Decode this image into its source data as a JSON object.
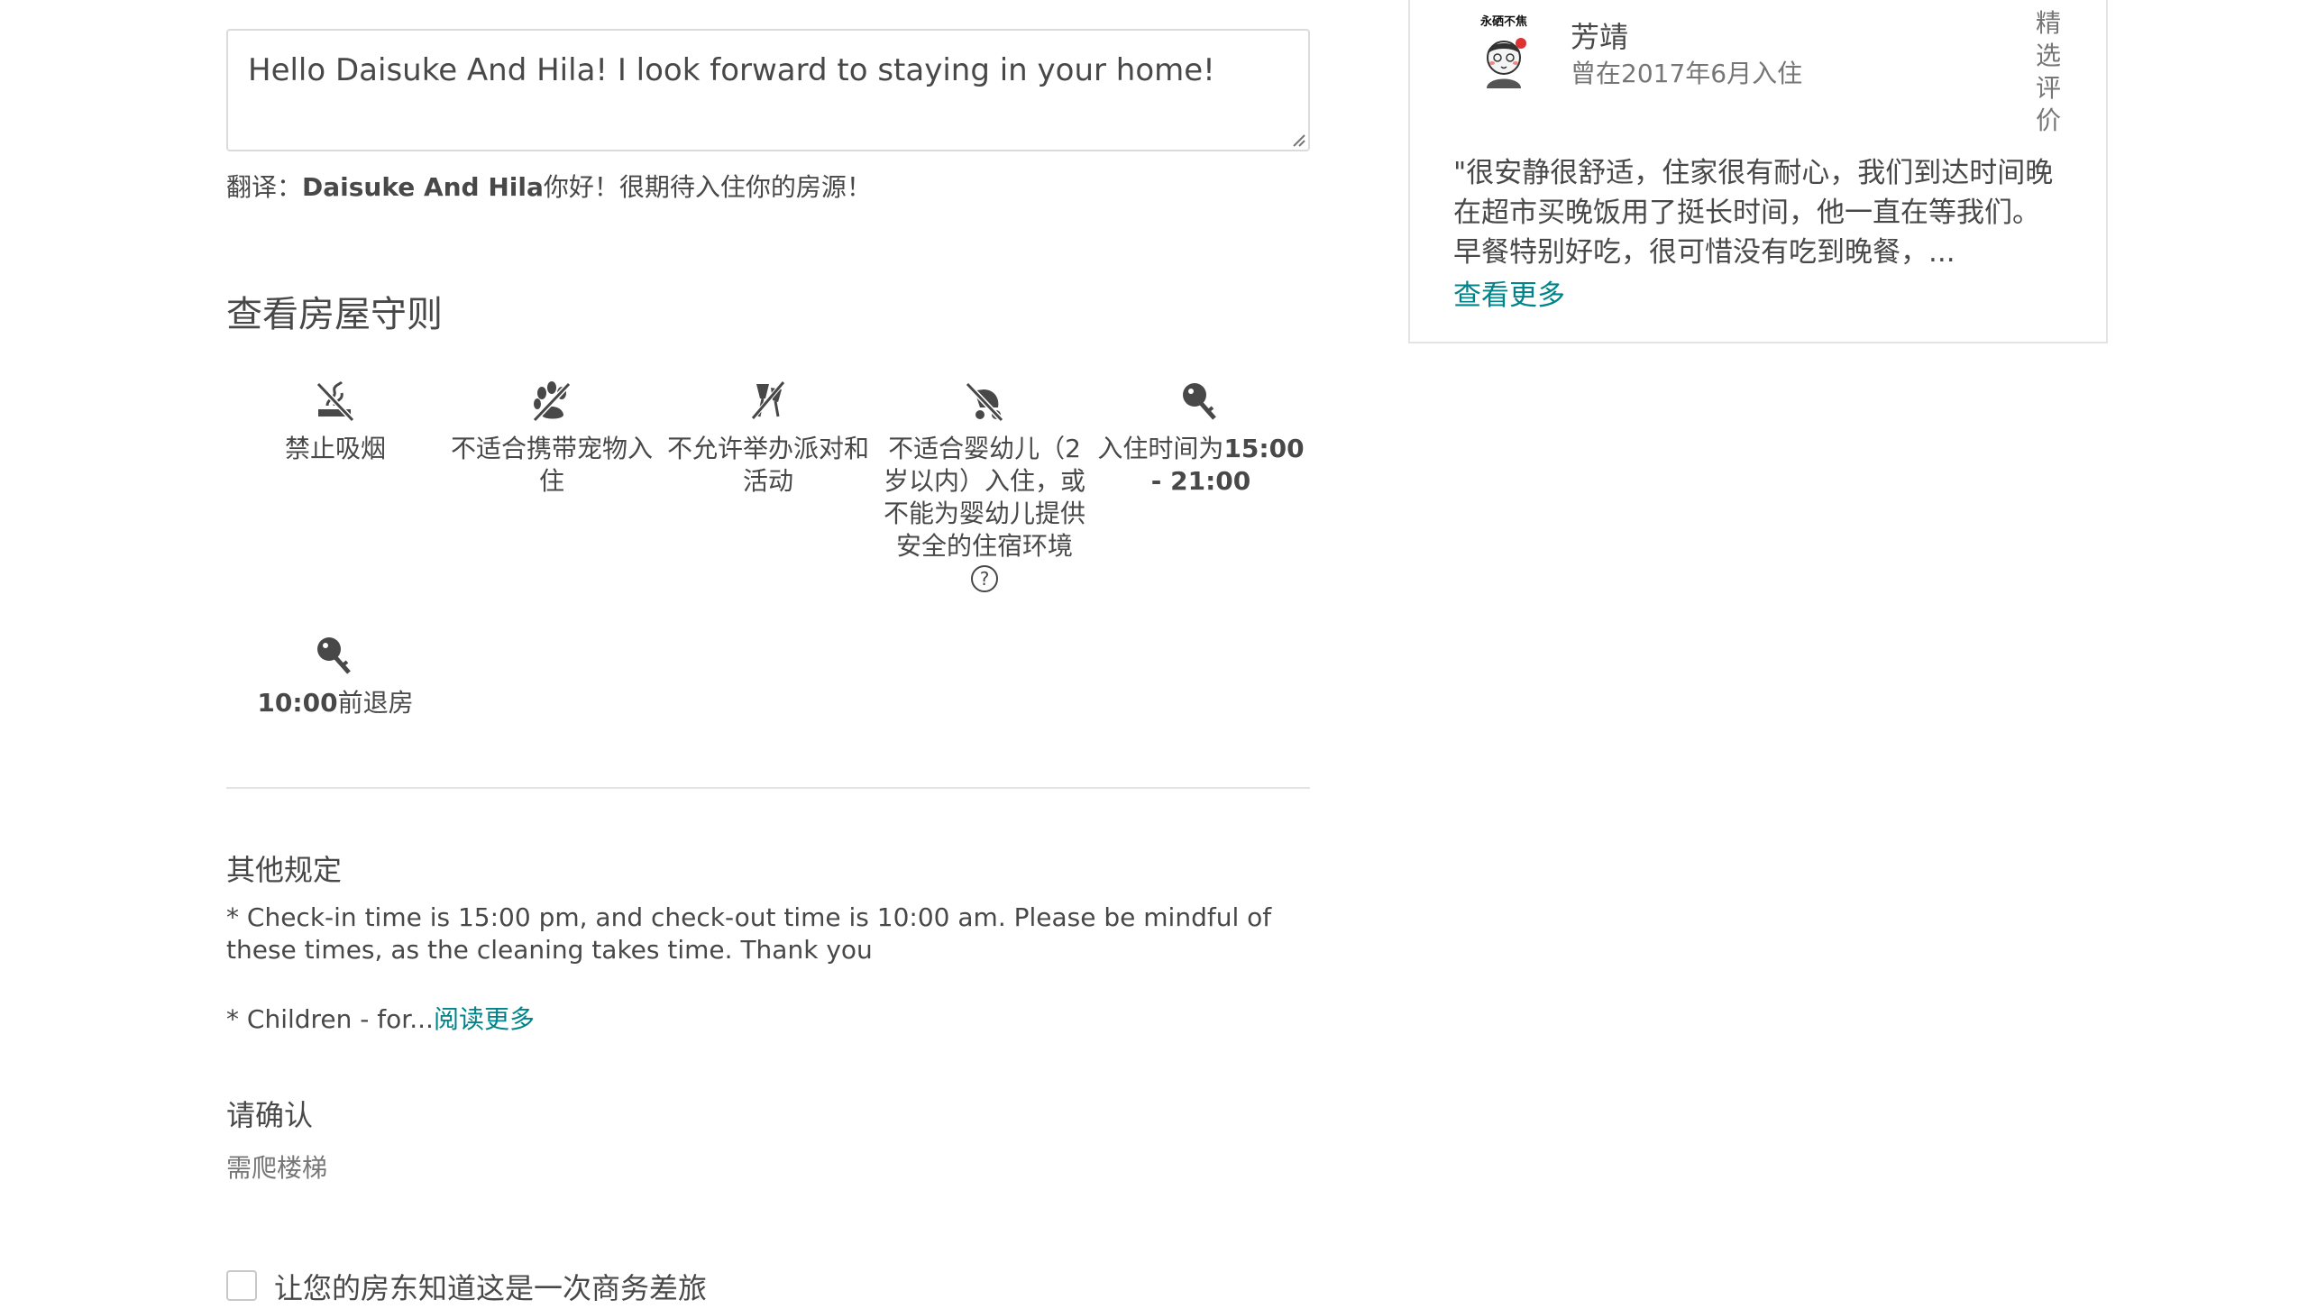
{
  "message": {
    "text": "Hello Daisuke And Hila! I look forward to staying in your home!",
    "translation_prefix": "翻译：",
    "translation_host": "Daisuke And Hila",
    "translation_rest": "你好！很期待入住你的房源！"
  },
  "house_rules": {
    "title": "查看房屋守则",
    "rules": [
      {
        "icon": "no-smoking-icon",
        "label": "禁止吸烟"
      },
      {
        "icon": "no-pets-icon",
        "label": "不适合携带宠物入住"
      },
      {
        "icon": "no-parties-icon",
        "label": "不允许举办派对和活动"
      },
      {
        "icon": "no-infants-icon",
        "label": "不适合婴幼儿（2岁以内）入住，或不能为婴幼儿提供安全的住宿环境"
      },
      {
        "icon": "key-icon",
        "label_prefix": "入住时间为",
        "label_bold": "15:00 - 21:00"
      },
      {
        "icon": "key-icon",
        "label_bold": "10:00",
        "label_suffix": "前退房"
      }
    ]
  },
  "other_rules": {
    "title": "其他规定",
    "text": "* Check-in time is 15:00 pm, and check-out time is 10:00 am. Please be mindful of these times, as the cleaning takes time. Thank you",
    "children_text": "* Children - for...",
    "read_more": "阅读更多"
  },
  "confirm": {
    "title": "请确认",
    "text": "需爬楼梯"
  },
  "business_trip": {
    "label": "让您的房东知道这是一次商务差旅",
    "checked": false
  },
  "review": {
    "avatar_caption": "永硒不焦",
    "reviewer_name": "芳靖",
    "stay_date": "曾在2017年6月入住",
    "badge": "精选评价",
    "text": "\"很安静很舒适，住家很有耐心，我们到达时间晚在超市买晚饭用了挺长时间，他一直在等我们。早餐特别好吃，很可惜没有吃到晚餐，...",
    "see_more": "查看更多"
  },
  "colors": {
    "text": "#484848",
    "muted": "#767676",
    "link": "#008489",
    "border": "#dbdbdb"
  }
}
